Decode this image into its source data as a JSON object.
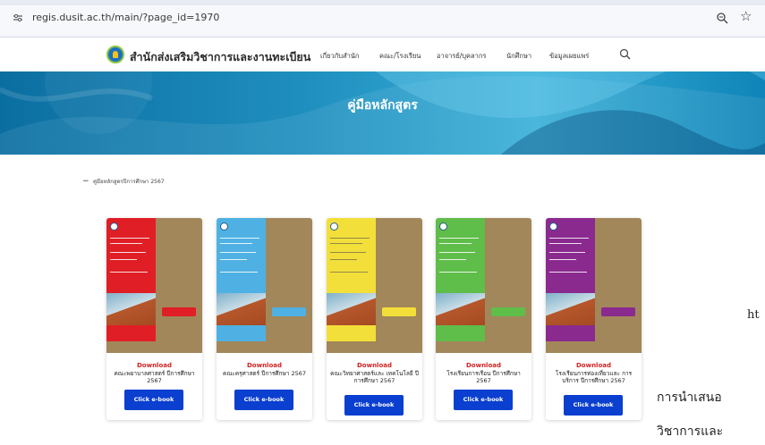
{
  "browser": {
    "url": "regis.dusit.ac.th/main/?page_id=1970",
    "icons": [
      "site-settings-icon",
      "zoom-icon",
      "bookmark-star-icon"
    ]
  },
  "site": {
    "title": "สำนักส่งเสริมวิชาการและงานทะเบียน",
    "nav": [
      "เกี่ยวกับสำนัก",
      "คณะ/โรงเรียน",
      "อาจารย์/บุคลากร",
      "นักศึกษา",
      "ข้อมูลเผยแพร่"
    ],
    "search_icon": "search-icon"
  },
  "hero": {
    "title": "คู่มือหลักสูตร"
  },
  "section": {
    "toggle": "−",
    "label": "คู่มือหลักสูตรปีการศึกษา 2567"
  },
  "cards": [
    {
      "download": "Download",
      "name": "คณะพยาบาลศาสตร์ ปีการศึกษา 2567",
      "button": "Click e-book",
      "color": "#e01e25"
    },
    {
      "download": "Download",
      "name": "คณะครุศาสตร์ ปีการศึกษา 2567",
      "button": "Click e-book",
      "color": "#4fb1e3"
    },
    {
      "download": "Download",
      "name": "คณะวิทยาศาสตร์และ เทคโนโลยี ปีการศึกษา 2567",
      "button": "Click e-book",
      "color": "#f3df3a"
    },
    {
      "download": "Download",
      "name": "โรงเรียนการเรือน ปีการศึกษา 2567",
      "button": "Click e-book",
      "color": "#5fbd4a"
    },
    {
      "download": "Download",
      "name": "โรงเรียนการท่องเที่ยวและ การบริการ ปีการศึกษา 2567",
      "button": "Click e-book",
      "color": "#8a2a8f"
    }
  ],
  "overlay": {
    "line0": "ht",
    "line1": "การนำเสนอ",
    "line2": "วิชาการและ"
  }
}
